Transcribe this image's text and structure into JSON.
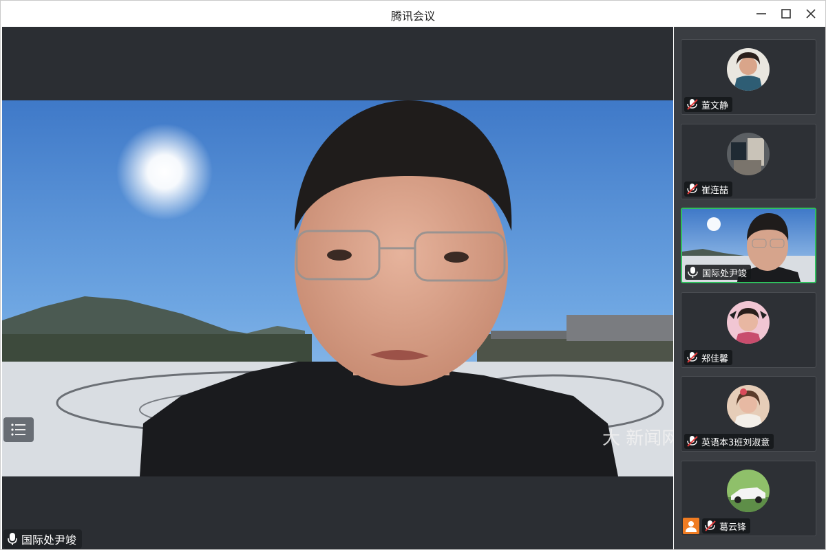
{
  "window": {
    "title": "腾讯会议",
    "controls": [
      "minimize-icon",
      "maximize-icon",
      "close-icon"
    ]
  },
  "main_video": {
    "speaker_name": "国际处尹竣",
    "mic": "microphone-icon",
    "watermark": "大 新闻网"
  },
  "participants": [
    {
      "name": "董文静",
      "mic": "mic-muted-icon",
      "avatar": "avatar-photo"
    },
    {
      "name": "崔连喆",
      "mic": "mic-muted-icon",
      "avatar": "avatar-photo"
    },
    {
      "name": "国际处尹竣",
      "mic": "microphone-icon",
      "video_on": true,
      "active": true
    },
    {
      "name": "郑佳馨",
      "mic": "mic-muted-icon",
      "avatar": "avatar-photo"
    },
    {
      "name": "英语本3班刘淑意",
      "mic": "mic-muted-icon",
      "avatar": "avatar-photo"
    },
    {
      "name": "葛云锋",
      "mic": "mic-muted-icon",
      "avatar": "avatar-photo",
      "badge": "person-icon"
    }
  ],
  "colors": {
    "active_border": "#2fbf5d",
    "badge": "#f07c22",
    "panel_bg": "#2b2e33"
  }
}
